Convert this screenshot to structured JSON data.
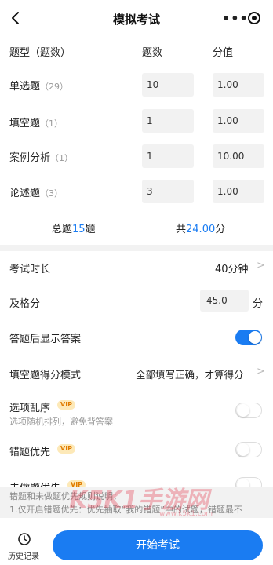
{
  "header": {
    "title": "模拟考试"
  },
  "columns": {
    "type": "题型（题数）",
    "count": "题数",
    "score": "分值"
  },
  "rows": [
    {
      "label": "单选题",
      "count": "（29）",
      "num": "10",
      "score": "1.00"
    },
    {
      "label": "填空题",
      "count": "（1）",
      "num": "1",
      "score": "1.00"
    },
    {
      "label": "案例分析",
      "count": "（1）",
      "num": "1",
      "score": "10.00"
    },
    {
      "label": "论述题",
      "count": "（3）",
      "num": "3",
      "score": "1.00"
    }
  ],
  "summary": {
    "total_prefix": "总题",
    "total_count": "15",
    "total_suffix": "题",
    "score_prefix": "共",
    "score_value": "24.00",
    "score_suffix": "分"
  },
  "settings": {
    "duration_label": "考试时长",
    "duration_value": "40分钟",
    "pass_label": "及格分",
    "pass_value": "45.0",
    "pass_unit": "分",
    "show_answer_label": "答题后显示答案",
    "show_answer_on": true,
    "fill_mode_label": "填空题得分模式",
    "fill_mode_value": "全部填写正确，才算得分",
    "shuffle_label": "选项乱序",
    "shuffle_sub": "选项随机排列，避免背答案",
    "shuffle_on": false,
    "wrong_first_label": "错题优先",
    "wrong_first_on": false,
    "undone_first_label": "未做题优先",
    "undone_first_on": false,
    "vip_badge": "VIP"
  },
  "note": {
    "line1": "错题和未做题优先规则说明：",
    "line2": "1.仅开启错题优先：优先抽取“我的错题”中的试题，错题最不"
  },
  "footer": {
    "history_label": "历史记录",
    "start_label": "开始考试"
  },
  "watermark": {
    "text": "K5K1手游网",
    "url": "www.k5k1.com"
  },
  "colors": {
    "accent": "#1a7cf2",
    "vip_text": "#e07b00",
    "vip_bg": "#fde9b8"
  }
}
